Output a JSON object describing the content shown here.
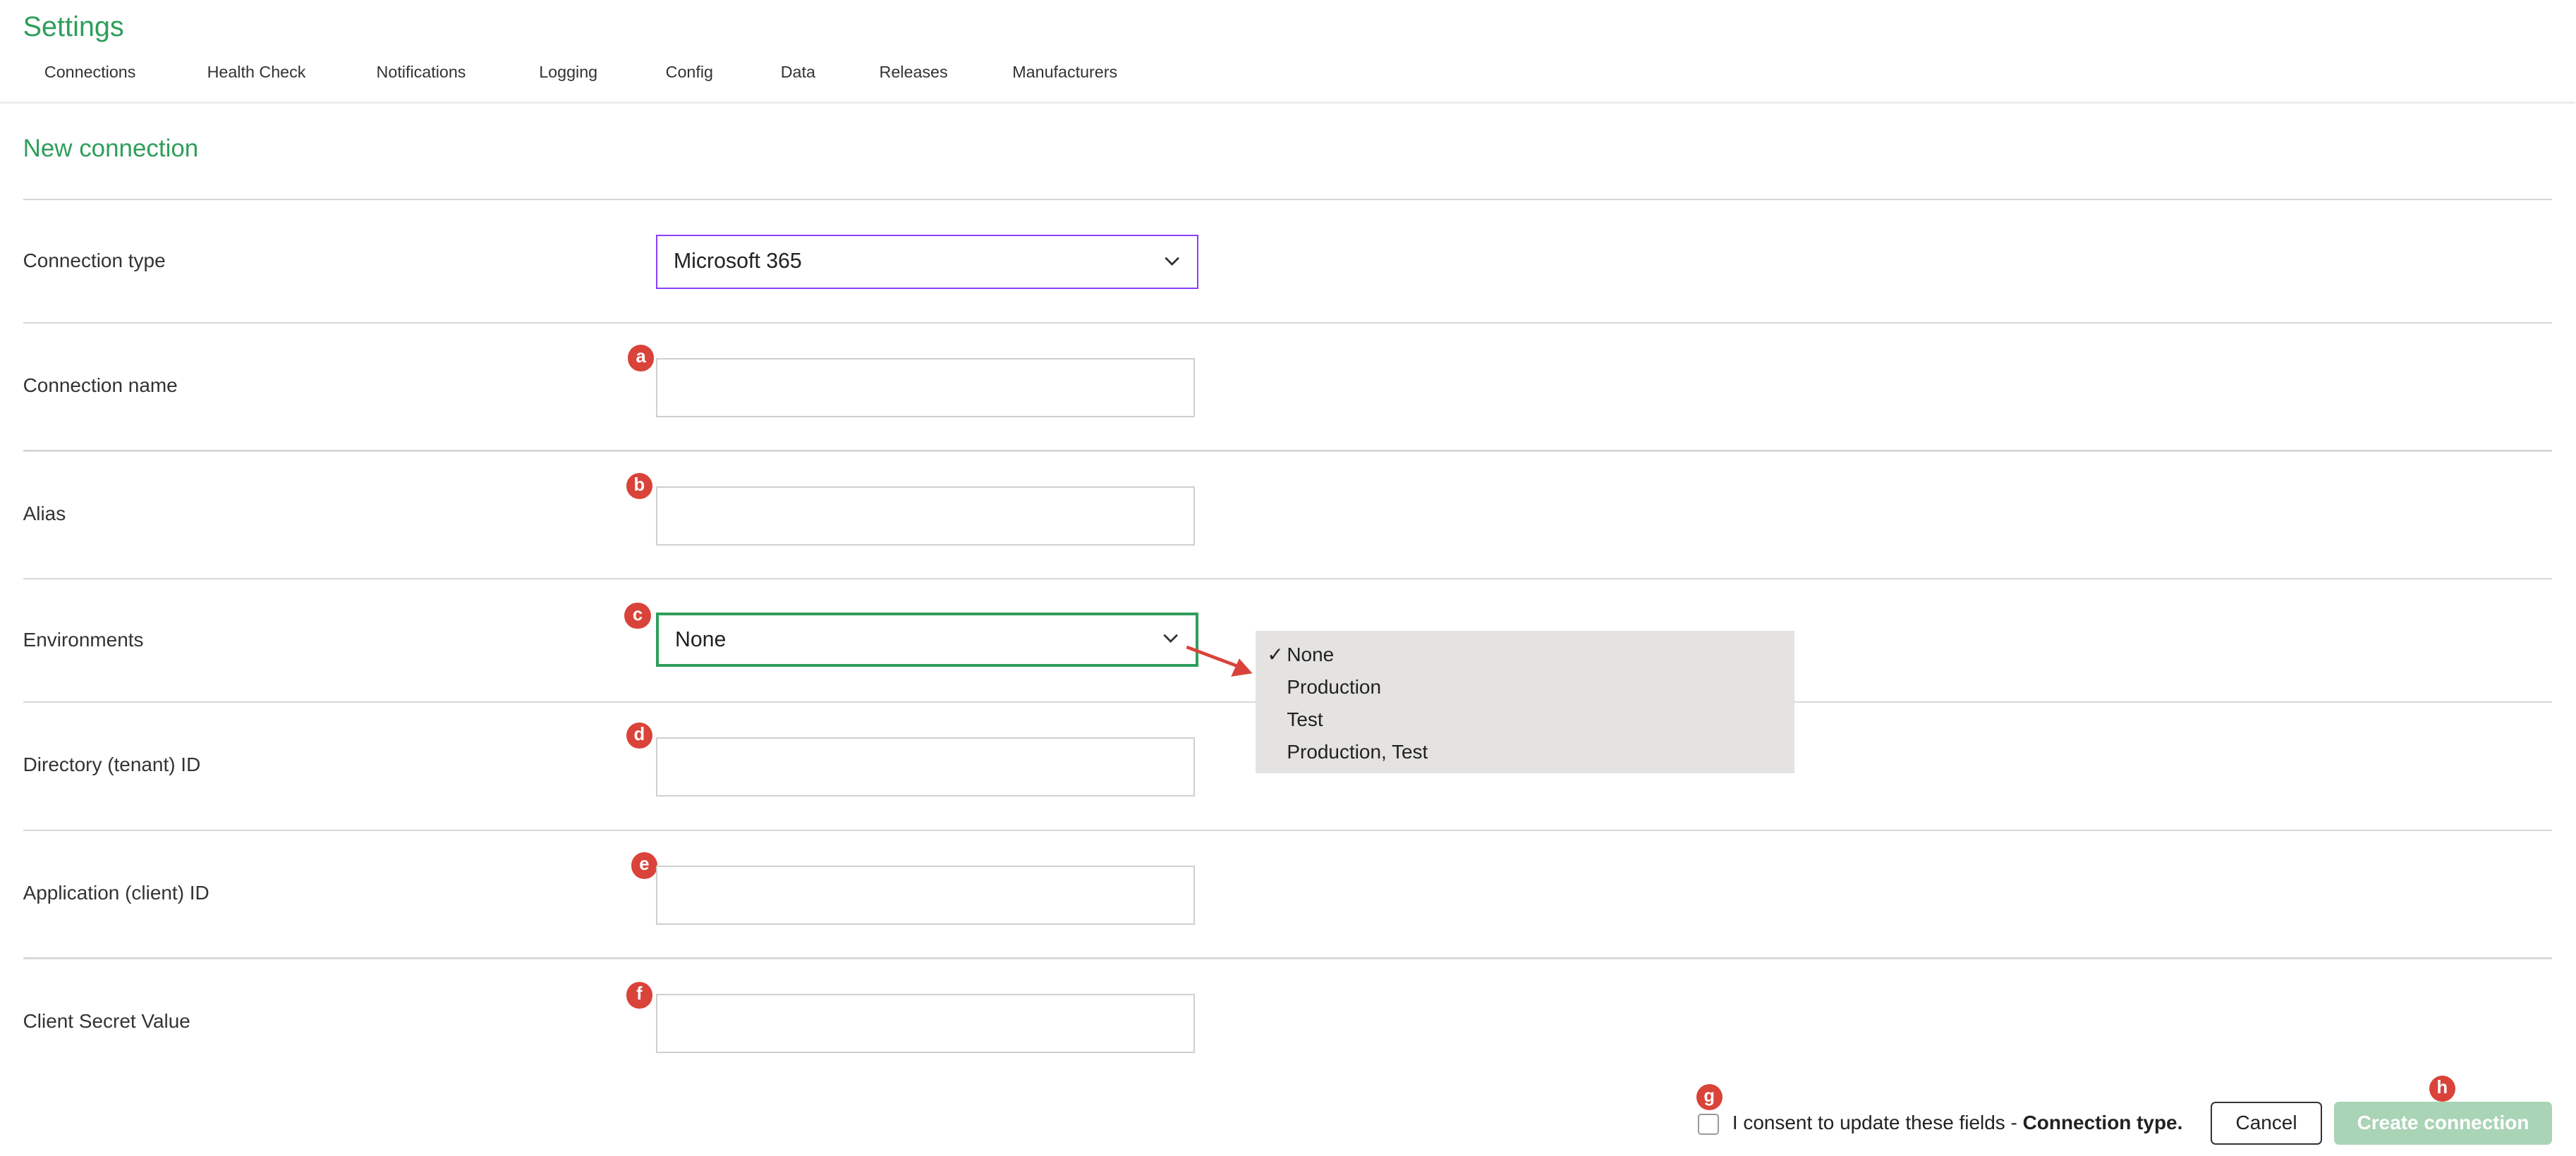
{
  "app": {
    "title": "Settings"
  },
  "nav": {
    "tabs": [
      {
        "label": "Connections"
      },
      {
        "label": "Health Check"
      },
      {
        "label": "Notifications"
      },
      {
        "label": "Logging"
      },
      {
        "label": "Config"
      },
      {
        "label": "Data"
      },
      {
        "label": "Releases"
      },
      {
        "label": "Manufacturers"
      }
    ]
  },
  "form": {
    "title": "New connection",
    "connection_type": {
      "label": "Connection type",
      "value": "Microsoft 365"
    },
    "connection_name": {
      "label": "Connection name",
      "value": "",
      "badge": "a"
    },
    "alias": {
      "label": "Alias",
      "value": "",
      "badge": "b"
    },
    "environments": {
      "label": "Environments",
      "value": "None",
      "badge": "c",
      "options": [
        {
          "label": "None",
          "checked": true
        },
        {
          "label": "Production",
          "checked": false
        },
        {
          "label": "Test",
          "checked": false
        },
        {
          "label": "Production, Test",
          "checked": false
        }
      ],
      "check_glyph": "✓"
    },
    "directory_id": {
      "label": "Directory (tenant) ID",
      "value": "",
      "badge": "d"
    },
    "application_id": {
      "label": "Application (client) ID",
      "value": "",
      "badge": "e"
    },
    "client_secret": {
      "label": "Client Secret Value",
      "value": "",
      "badge": "f"
    }
  },
  "footer": {
    "consent_badge": "g",
    "consent_text": "I consent to update these fields - ",
    "consent_bold": "Connection type.",
    "cancel_label": "Cancel",
    "create_label": "Create connection",
    "create_badge": "h"
  },
  "colors": {
    "brand_green": "#2e9e5b",
    "badge_red": "#d9433a",
    "focus_purple": "#8a3ffc",
    "create_disabled": "#a9d4b6"
  },
  "icons": {
    "chevron": "chevron-down-icon",
    "arrow": "red-arrow-icon"
  }
}
